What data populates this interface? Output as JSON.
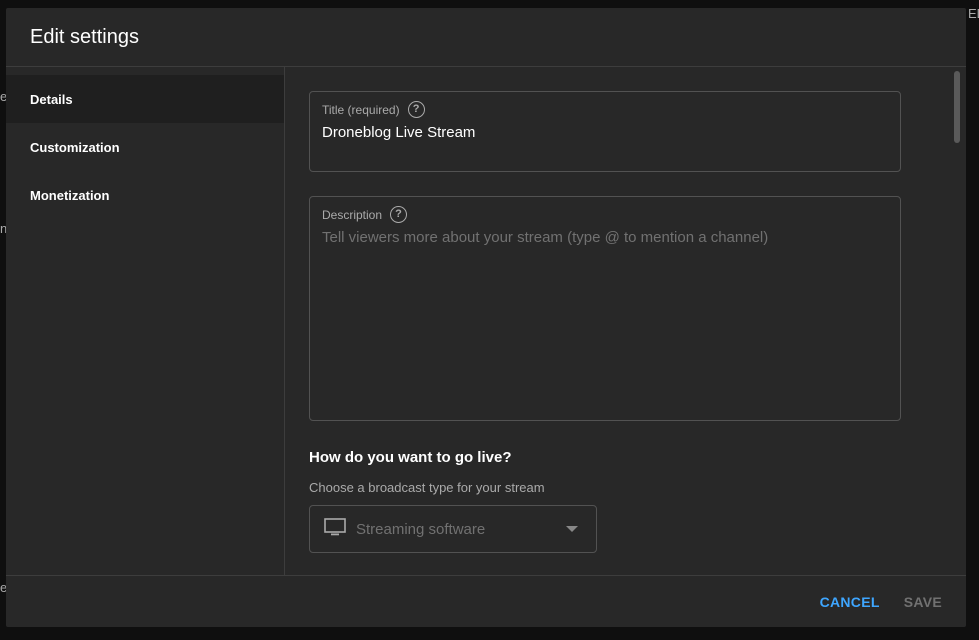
{
  "background": {
    "fragments": [
      "ED",
      "e",
      "n",
      "e"
    ]
  },
  "dialog": {
    "title": "Edit settings"
  },
  "sidebar": {
    "items": [
      {
        "label": "Details",
        "active": true
      },
      {
        "label": "Customization",
        "active": false
      },
      {
        "label": "Monetization",
        "active": false
      }
    ]
  },
  "form": {
    "title_field": {
      "label": "Title (required)",
      "value": "Droneblog Live Stream"
    },
    "description_field": {
      "label": "Description",
      "placeholder": "Tell viewers more about your stream (type @ to mention a channel)"
    },
    "go_live": {
      "heading": "How do you want to go live?",
      "subheading": "Choose a broadcast type for your stream",
      "selected": "Streaming software",
      "icon": "monitor-icon"
    }
  },
  "footer": {
    "cancel_label": "CANCEL",
    "save_label": "SAVE"
  },
  "colors": {
    "accent": "#3ea6ff",
    "dialog_bg": "#282828",
    "active_nav_bg": "#1f1f1f"
  }
}
